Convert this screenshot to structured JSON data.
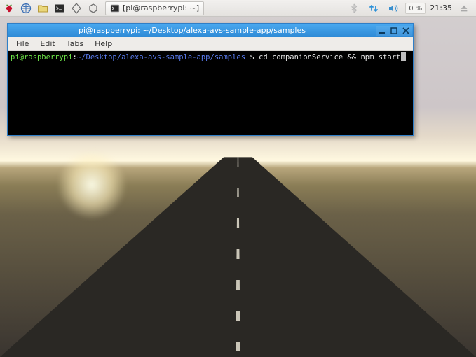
{
  "taskbar": {
    "task_item_label": "[pi@raspberrypi: ~]",
    "cpu_badge": "0 %",
    "clock": "21:35"
  },
  "window": {
    "title": "pi@raspberrypi: ~/Desktop/alexa-avs-sample-app/samples",
    "menus": {
      "file": "File",
      "edit": "Edit",
      "tabs": "Tabs",
      "help": "Help"
    }
  },
  "terminal": {
    "user": "pi",
    "at": "@",
    "host": "raspberrypi",
    "colon": ":",
    "path": "~/Desktop/alexa-avs-sample-app/samples",
    "prompt_symbol": " $ ",
    "command": "cd companionService && npm start"
  }
}
